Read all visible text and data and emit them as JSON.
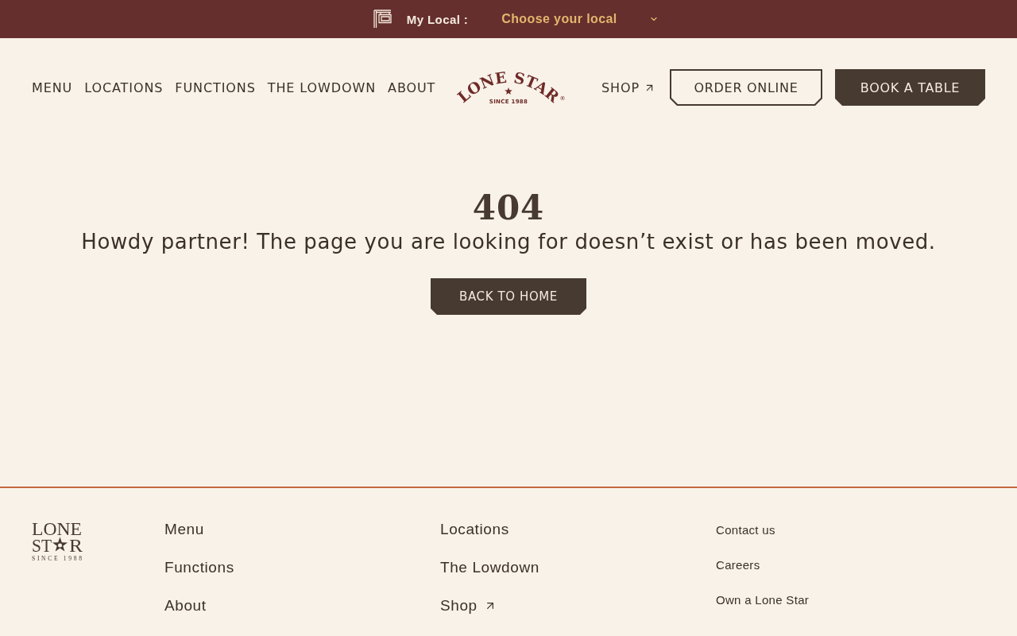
{
  "top_bar": {
    "label": "My Local :",
    "select": {
      "value": "Choose your local"
    }
  },
  "header": {
    "links": [
      {
        "label": "MENU"
      },
      {
        "label": "LOCATIONS"
      },
      {
        "label": "FUNCTIONS"
      },
      {
        "label": "THE LOWDOWN"
      },
      {
        "label": "ABOUT"
      }
    ],
    "logo": {
      "name": "LONE STAR",
      "mark": "®",
      "tagline": "SINCE 1988"
    },
    "shop": {
      "label": "SHOP",
      "external": true
    },
    "buttons": [
      {
        "label": "ORDER ONLINE",
        "kind": "outline"
      },
      {
        "label": "BOOK A TABLE",
        "kind": "filled"
      }
    ]
  },
  "error": {
    "code": "404",
    "message": "Howdy partner! The page you are looking for doesn’t exist or has been moved.",
    "button": "BACK TO HOME"
  },
  "footer": {
    "logo": {
      "top": "LONE",
      "bottom_left": "ST",
      "bottom_right": "R",
      "tagline": "SINCE 1988"
    },
    "columns": [
      {
        "kind": "main",
        "links": [
          {
            "label": "Menu",
            "external": false
          },
          {
            "label": "Functions",
            "external": false
          },
          {
            "label": "About",
            "external": false
          }
        ]
      },
      {
        "kind": "main",
        "links": [
          {
            "label": "Locations",
            "external": false
          },
          {
            "label": "The Lowdown",
            "external": false
          },
          {
            "label": "Shop",
            "external": true
          }
        ]
      },
      {
        "kind": "small",
        "links": [
          {
            "label": "Contact us",
            "external": false
          },
          {
            "label": "Careers",
            "external": false
          },
          {
            "label": "Own a Lone Star",
            "external": false
          }
        ]
      }
    ]
  }
}
